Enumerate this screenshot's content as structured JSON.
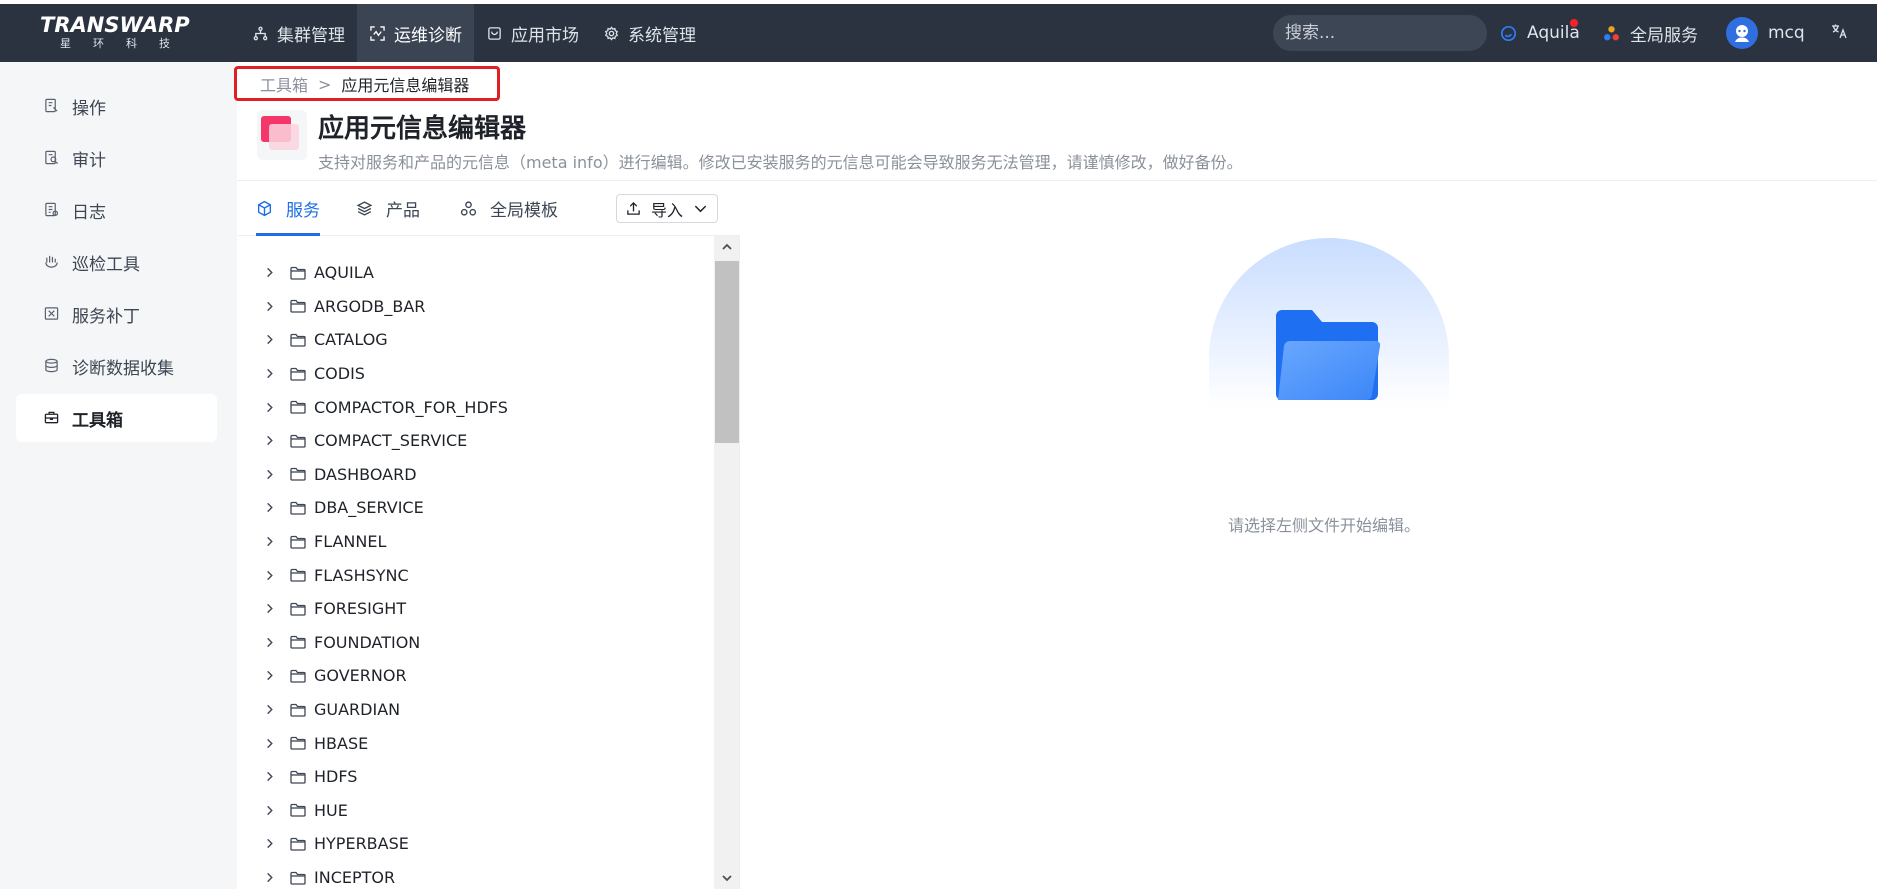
{
  "topbar": {
    "logo_word": "TRANSWARP",
    "logo_sub": "星环科技",
    "nav": [
      {
        "label": "集群管理",
        "icon": "cluster-icon"
      },
      {
        "label": "运维诊断",
        "icon": "diagnose-icon",
        "active": true
      },
      {
        "label": "应用市场",
        "icon": "market-icon"
      },
      {
        "label": "系统管理",
        "icon": "gear-icon"
      }
    ],
    "search_placeholder": "搜索...",
    "aquila": "Aquila",
    "global_service": "全局服务",
    "user": "mcq",
    "lang_icon": "translate-icon"
  },
  "sidebar": {
    "items": [
      {
        "label": "操作",
        "icon": "operation-icon"
      },
      {
        "label": "审计",
        "icon": "audit-icon"
      },
      {
        "label": "日志",
        "icon": "log-icon"
      },
      {
        "label": "巡检工具",
        "icon": "inspect-icon"
      },
      {
        "label": "服务补丁",
        "icon": "patch-icon"
      },
      {
        "label": "诊断数据收集",
        "icon": "collect-icon"
      },
      {
        "label": "工具箱",
        "icon": "toolbox-icon",
        "active": true
      }
    ]
  },
  "breadcrumb": {
    "parent": "工具箱",
    "separator": ">",
    "current": "应用元信息编辑器"
  },
  "page": {
    "title": "应用元信息编辑器",
    "description": "支持对服务和产品的元信息（meta info）进行编辑。修改已安装服务的元信息可能会导致服务无法管理，请谨慎修改，做好备份。"
  },
  "tabs": [
    {
      "label": "服务",
      "icon": "service-cube-icon",
      "active": true
    },
    {
      "label": "产品",
      "icon": "layers-icon"
    },
    {
      "label": "全局模板",
      "icon": "template-icon"
    }
  ],
  "import_button": "导入",
  "tree": [
    "AQUILA",
    "ARGODB_BAR",
    "CATALOG",
    "CODIS",
    "COMPACTOR_FOR_HDFS",
    "COMPACT_SERVICE",
    "DASHBOARD",
    "DBA_SERVICE",
    "FLANNEL",
    "FLASHSYNC",
    "FORESIGHT",
    "FOUNDATION",
    "GOVERNOR",
    "GUARDIAN",
    "HBASE",
    "HDFS",
    "HUE",
    "HYPERBASE",
    "INCEPTOR"
  ],
  "empty_state": {
    "text": "请选择左侧文件开始编辑。"
  },
  "colors": {
    "topbar": "#2b3340",
    "accent": "#1e6fe6",
    "highlight_box": "#e02020"
  }
}
